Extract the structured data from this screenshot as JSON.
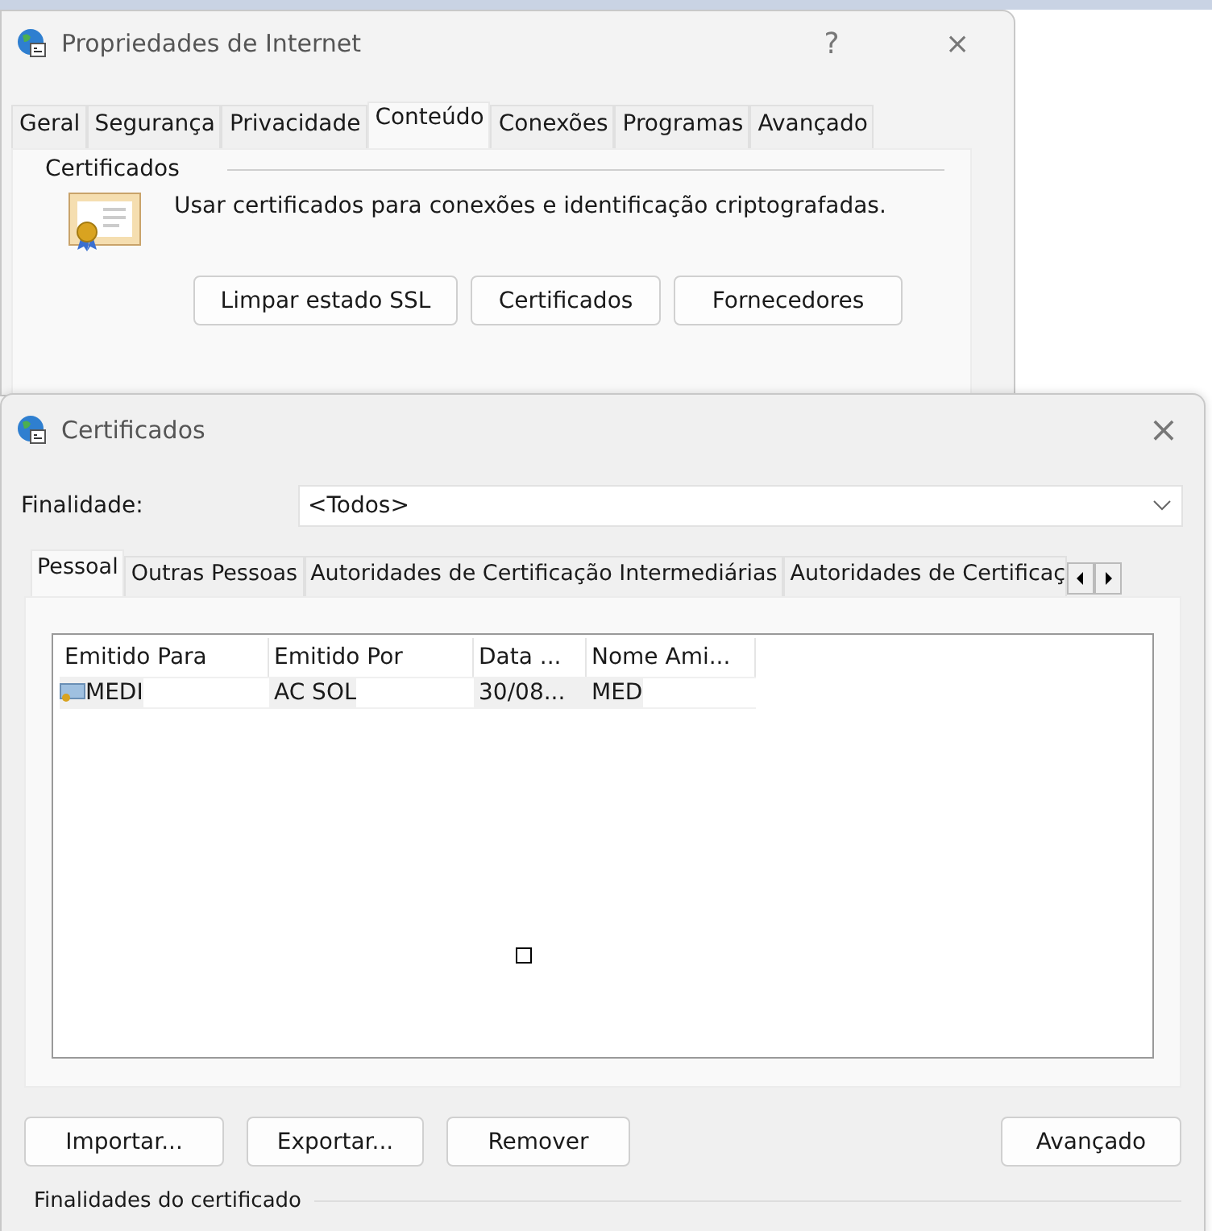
{
  "back_window": {
    "title": "Propriedades de Internet",
    "help": "?",
    "close": "×",
    "tabs": [
      {
        "label": "Geral",
        "selected": false
      },
      {
        "label": "Segurança",
        "selected": false
      },
      {
        "label": "Privacidade",
        "selected": false
      },
      {
        "label": "Conteúdo",
        "selected": true
      },
      {
        "label": "Conexões",
        "selected": false
      },
      {
        "label": "Programas",
        "selected": false
      },
      {
        "label": "Avançado",
        "selected": false
      }
    ],
    "section": "Certificados",
    "description": "Usar certificados para conexões e identificação criptografadas.",
    "buttons": [
      "Limpar estado SSL",
      "Certificados",
      "Fornecedores"
    ]
  },
  "front_window": {
    "title": "Certificados",
    "close": "×",
    "purpose": {
      "label": "Finalidade:",
      "value": "<Todos>"
    },
    "tabs": [
      {
        "label": "Pessoal",
        "selected": true
      },
      {
        "label": "Outras Pessoas",
        "selected": false
      },
      {
        "label": "Autoridades de Certificação Intermediárias",
        "selected": false
      },
      {
        "label": "Autoridades de Certificaç",
        "selected": false
      }
    ],
    "table": {
      "columns": [
        "Emitido Para",
        "Emitido Por",
        "Data ...",
        "Nome Ami..."
      ],
      "rows": [
        {
          "cells": [
            "MEDI",
            "AC SOL",
            "30/08...",
            "MED"
          ],
          "selected": false
        }
      ]
    },
    "buttons": [
      "Importar...",
      "Exportar...",
      "Remover"
    ],
    "advanced_button": "Avançado",
    "section": "Finalidades do certificado"
  }
}
